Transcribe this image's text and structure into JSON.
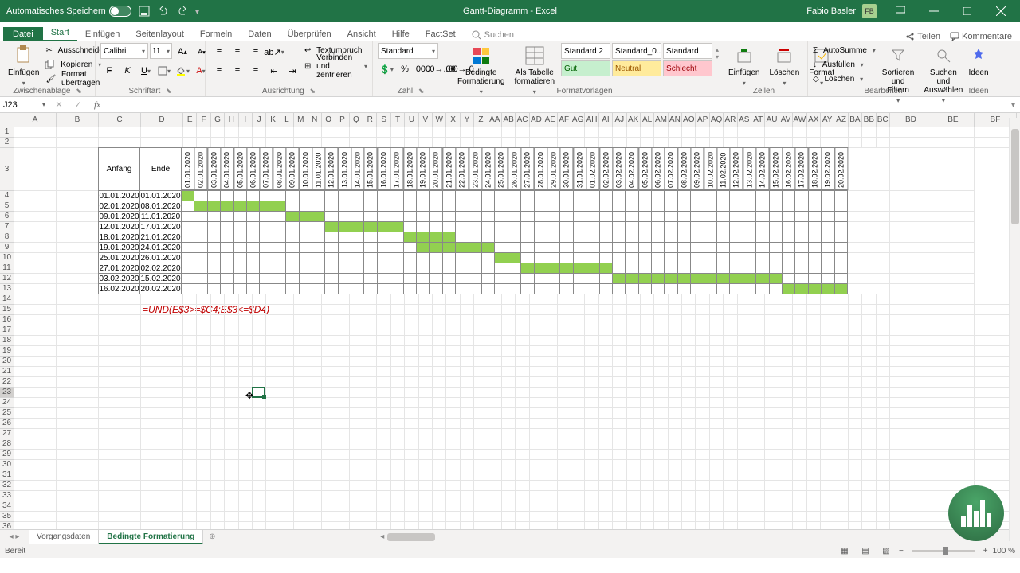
{
  "titlebar": {
    "autosave": "Automatisches Speichern",
    "title": "Gantt-Diagramm - Excel",
    "user": "Fabio Basler",
    "initials": "FB"
  },
  "tabs": {
    "file": "Datei",
    "home": "Start",
    "insert": "Einfügen",
    "pagelayout": "Seitenlayout",
    "formulas": "Formeln",
    "data": "Daten",
    "review": "Überprüfen",
    "view": "Ansicht",
    "help": "Hilfe",
    "factset": "FactSet",
    "search": "Suchen",
    "share": "Teilen",
    "comments": "Kommentare"
  },
  "ribbon": {
    "paste": "Einfügen",
    "cut": "Ausschneiden",
    "copy": "Kopieren",
    "format_painter": "Format übertragen",
    "clipboard": "Zwischenablage",
    "font_name": "Calibri",
    "font_size": "11",
    "font_group": "Schriftart",
    "wrap": "Textumbruch",
    "merge": "Verbinden und zentrieren",
    "align_group": "Ausrichtung",
    "numfmt": "Standard",
    "num_group": "Zahl",
    "condfmt": "Bedingte Formatierung",
    "astable": "Als Tabelle formatieren",
    "style_std2": "Standard 2",
    "style_std0": "Standard_0...",
    "style_std": "Standard",
    "style_gut": "Gut",
    "style_neutral": "Neutral",
    "style_schlecht": "Schlecht",
    "styles_group": "Formatvorlagen",
    "insert_cells": "Einfügen",
    "delete_cells": "Löschen",
    "format_cells": "Format",
    "cells_group": "Zellen",
    "autosum": "AutoSumme",
    "fill": "Ausfüllen",
    "clear": "Löschen",
    "sortfilter": "Sortieren und Filtern",
    "findselect": "Suchen und Auswählen",
    "editing_group": "Bearbeiten",
    "ideas": "Ideen",
    "ideas_group": "Ideen"
  },
  "namebox": "J23",
  "columns_main": [
    "A",
    "B",
    "C",
    "D"
  ],
  "columns_narrow": [
    "E",
    "F",
    "G",
    "H",
    "I",
    "J",
    "K",
    "L",
    "M",
    "N",
    "O",
    "P",
    "Q",
    "R",
    "S",
    "T",
    "U",
    "V",
    "W",
    "X",
    "Y",
    "Z",
    "AA",
    "AB",
    "AC",
    "AD",
    "AE",
    "AF",
    "AG",
    "AH",
    "AI",
    "AJ",
    "AK",
    "AL",
    "AM",
    "AN",
    "AO",
    "AP",
    "AQ",
    "AR",
    "AS",
    "AT",
    "AU",
    "AV",
    "AW",
    "AX",
    "AY",
    "AZ",
    "BA",
    "BB",
    "BC"
  ],
  "columns_end": [
    "BD",
    "BE",
    "BF"
  ],
  "gantt": {
    "header_start": "Anfang",
    "header_end": "Ende",
    "dates": [
      "01.01.2020",
      "02.01.2020",
      "03.01.2020",
      "04.01.2020",
      "05.01.2020",
      "06.01.2020",
      "07.01.2020",
      "08.01.2020",
      "09.01.2020",
      "10.01.2020",
      "11.01.2020",
      "12.01.2020",
      "13.01.2020",
      "14.01.2020",
      "15.01.2020",
      "16.01.2020",
      "17.01.2020",
      "18.01.2020",
      "19.01.2020",
      "20.01.2020",
      "21.01.2020",
      "22.01.2020",
      "23.01.2020",
      "24.01.2020",
      "25.01.2020",
      "26.01.2020",
      "27.01.2020",
      "28.01.2020",
      "29.01.2020",
      "30.01.2020",
      "31.01.2020",
      "01.02.2020",
      "02.02.2020",
      "03.02.2020",
      "04.02.2020",
      "05.02.2020",
      "06.02.2020",
      "07.02.2020",
      "08.02.2020",
      "09.02.2020",
      "10.02.2020",
      "11.02.2020",
      "12.02.2020",
      "13.02.2020",
      "14.02.2020",
      "15.02.2020",
      "16.02.2020",
      "17.02.2020",
      "18.02.2020",
      "19.02.2020",
      "20.02.2020"
    ],
    "rows": [
      {
        "start": "01.01.2020",
        "end": "01.01.2020",
        "from": 0,
        "to": 0
      },
      {
        "start": "02.01.2020",
        "end": "08.01.2020",
        "from": 1,
        "to": 7
      },
      {
        "start": "09.01.2020",
        "end": "11.01.2020",
        "from": 8,
        "to": 10
      },
      {
        "start": "12.01.2020",
        "end": "17.01.2020",
        "from": 11,
        "to": 16
      },
      {
        "start": "18.01.2020",
        "end": "21.01.2020",
        "from": 17,
        "to": 20
      },
      {
        "start": "19.01.2020",
        "end": "24.01.2020",
        "from": 18,
        "to": 23
      },
      {
        "start": "25.01.2020",
        "end": "26.01.2020",
        "from": 24,
        "to": 25
      },
      {
        "start": "27.01.2020",
        "end": "02.02.2020",
        "from": 26,
        "to": 32
      },
      {
        "start": "03.02.2020",
        "end": "15.02.2020",
        "from": 33,
        "to": 45
      },
      {
        "start": "16.02.2020",
        "end": "20.02.2020",
        "from": 46,
        "to": 50
      }
    ],
    "formula": "=UND(E$3>=$C4;E$3<=$D4)"
  },
  "sheets": {
    "tab1": "Vorgangsdaten",
    "tab2": "Bedingte Formatierung"
  },
  "status": {
    "ready": "Bereit",
    "zoom": "100 %"
  }
}
